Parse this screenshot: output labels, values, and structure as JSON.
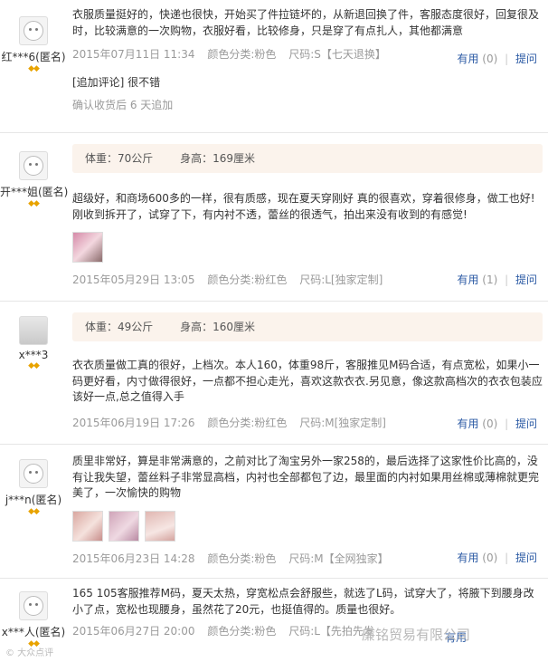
{
  "reviews": [
    {
      "user": "红***6(匿名)",
      "avatar": "default-avatar",
      "text": "衣服质量挺好的，快递也很快，开始买了件拉链坏的，从新退回换了件，客服态度很好，回复很及时，比较满意的一次购物，衣服好看，比较修身，只是穿了有点扎人，其他都满意",
      "date": "2015年07月11日 11:34",
      "color": "颜色分类:粉色",
      "size": "尺码:S【七天退换】",
      "useful": "有用",
      "useful_count": "(0)",
      "reply": "提问",
      "followup": "[追加评论] 很不错",
      "followup_note": "确认收货后 6 天追加"
    },
    {
      "user": "开***姐(匿名)",
      "avatar": "default-avatar",
      "weight": "体重：70公斤",
      "height": "身高：169厘米",
      "text": "超级好，和商场600多的一样，很有质感，现在夏天穿刚好 真的很喜欢，穿着很修身，做工也好! 刚收到拆开了，试穿了下，有内衬不透，蕾丝的很透气，拍出来没有收到的有感觉!",
      "date": "2015年05月29日 13:05",
      "color": "颜色分类:粉红色",
      "size": "尺码:L[独家定制]",
      "useful": "有用",
      "useful_count": "(1)",
      "reply": "提问"
    },
    {
      "user": "x***3",
      "avatar": "photo-avatar",
      "weight": "体重：49公斤",
      "height": "身高：160厘米",
      "text": "衣衣质量做工真的很好，上档次。本人160，体重98斤，客服推见M码合适，有点宽松，如果小一码更好看，内寸做得很好，一点都不担心走光，喜欢这款衣衣.另见意，像这款高档次的衣衣包装应该好一点,总之值得入手",
      "date": "2015年06月19日 17:26",
      "color": "颜色分类:粉红色",
      "size": "尺码:M[独家定制]",
      "useful": "有用",
      "useful_count": "(0)",
      "reply": "提问"
    },
    {
      "user": "j***n(匿名)",
      "avatar": "default-avatar",
      "text": "质里非常好，算是非常满意的，之前对比了淘宝另外一家258的，最后选择了这家性价比高的，没有让我失望，蕾丝料子非常显高档，内衬也全部都包了边，最里面的内衬如果用丝棉或薄棉就更完美了，一次愉快的购物",
      "date": "2015年06月23日 14:28",
      "color": "颜色分类:粉色",
      "size": "尺码:M【全网独家】",
      "useful": "有用",
      "useful_count": "(0)",
      "reply": "提问"
    },
    {
      "user": "x***人(匿名)",
      "avatar": "default-avatar",
      "text": "165 105客服推荐M码，夏天太热，穿宽松点会舒服些，就选了L码，试穿大了，将腋下到腰身改小了点，宽松也现腰身，虽然花了20元，也挺值得的。质量也很好。",
      "date": "2015年06月27日 20:00",
      "color": "颜色分类:粉色",
      "size": "尺码:L【先拍先发",
      "useful": "有用"
    }
  ],
  "watermark": "廉铭贸易有限公司",
  "watermark_left": "© 大众点评"
}
